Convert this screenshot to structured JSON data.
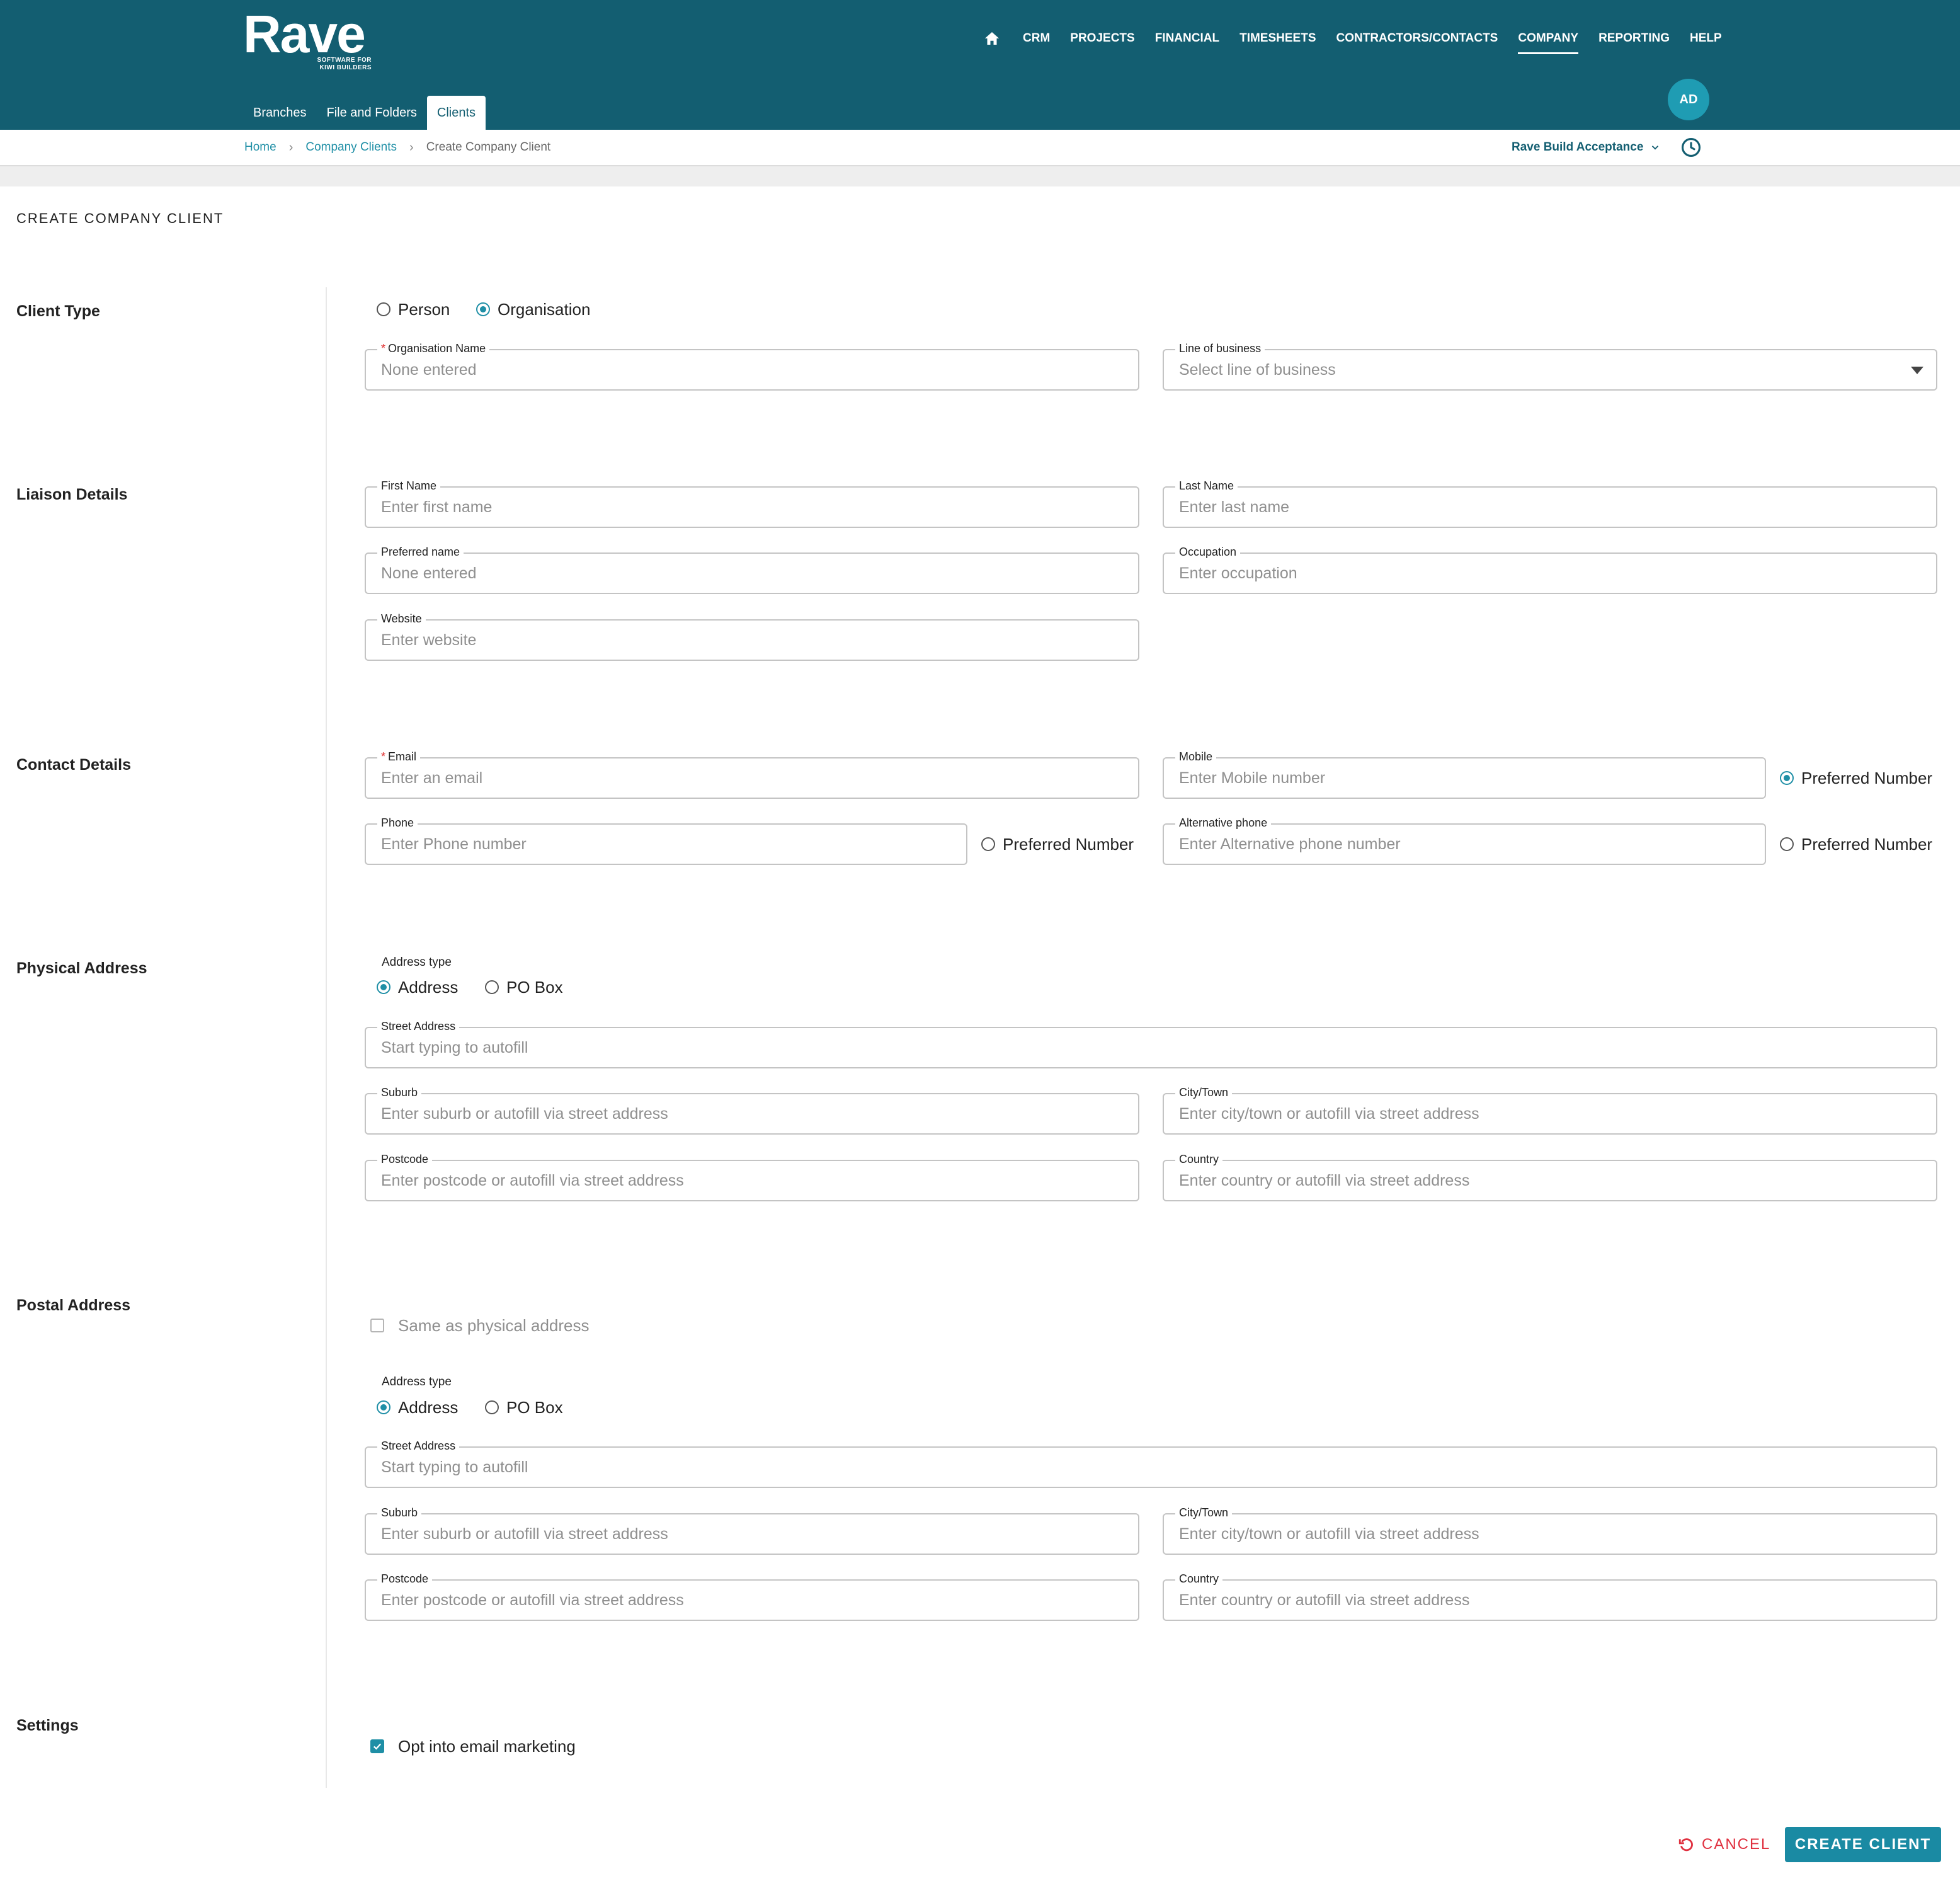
{
  "brand": {
    "name": "Rave",
    "tagline_line1": "SOFTWARE FOR",
    "tagline_line2": "KIWI BUILDERS"
  },
  "topnav": {
    "items": [
      {
        "label": "CRM"
      },
      {
        "label": "PROJECTS"
      },
      {
        "label": "FINANCIAL"
      },
      {
        "label": "TIMESHEETS"
      },
      {
        "label": "CONTRACTORS/CONTACTS"
      },
      {
        "label": "COMPANY",
        "active": true
      },
      {
        "label": "REPORTING"
      },
      {
        "label": "HELP"
      }
    ],
    "avatar_initials": "AD"
  },
  "subtabs": [
    {
      "label": "Branches"
    },
    {
      "label": "File and Folders"
    },
    {
      "label": "Clients",
      "active": true
    }
  ],
  "breadcrumb": {
    "home": "Home",
    "parent": "Company Clients",
    "current": "Create Company Client"
  },
  "org_selector": {
    "label": "Rave Build Acceptance"
  },
  "page": {
    "title": "CREATE COMPANY CLIENT"
  },
  "sections": {
    "client_type": "Client Type",
    "liaison": "Liaison Details",
    "contact": "Contact Details",
    "physical": "Physical Address",
    "postal": "Postal Address",
    "settings": "Settings"
  },
  "client_type": {
    "person": "Person",
    "organisation": "Organisation",
    "selected": "Organisation"
  },
  "org": {
    "name_label": "Organisation Name",
    "name_value": "None entered",
    "lob_label": "Line of business",
    "lob_placeholder": "Select line of business"
  },
  "liaison": {
    "first_label": "First Name",
    "first_placeholder": "Enter first name",
    "last_label": "Last Name",
    "last_placeholder": "Enter last name",
    "preferred_label": "Preferred name",
    "preferred_value": "None entered",
    "occupation_label": "Occupation",
    "occupation_placeholder": "Enter occupation",
    "website_label": "Website",
    "website_placeholder": "Enter website"
  },
  "contact": {
    "email_label": "Email",
    "email_placeholder": "Enter an email",
    "mobile_label": "Mobile",
    "mobile_placeholder": "Enter Mobile number",
    "phone_label": "Phone",
    "phone_placeholder": "Enter Phone number",
    "alt_label": "Alternative phone",
    "alt_placeholder": "Enter Alternative phone number",
    "preferred_number": "Preferred Number",
    "preferred_selected": "mobile"
  },
  "address_common": {
    "type_label": "Address type",
    "opt_address": "Address",
    "opt_pobox": "PO Box",
    "street_label": "Street Address",
    "street_placeholder": "Start typing to autofill",
    "suburb_label": "Suburb",
    "suburb_placeholder": "Enter suburb or autofill via street address",
    "city_label": "City/Town",
    "city_placeholder": "Enter city/town or autofill via street address",
    "postcode_label": "Postcode",
    "postcode_placeholder": "Enter postcode or autofill via street address",
    "country_label": "Country",
    "country_placeholder": "Enter country or autofill via street address"
  },
  "physical_address": {
    "type_selected": "Address"
  },
  "postal_address": {
    "same_as_physical": "Same as physical address",
    "same_checked": false,
    "type_selected": "Address"
  },
  "settings": {
    "email_marketing": "Opt into email marketing",
    "email_marketing_checked": true
  },
  "actions": {
    "cancel": "CANCEL",
    "create": "CREATE CLIENT"
  },
  "colors": {
    "header": "#135e71",
    "accent": "#1f8fa6",
    "button": "#1a8aa3",
    "danger": "#e0303f"
  }
}
